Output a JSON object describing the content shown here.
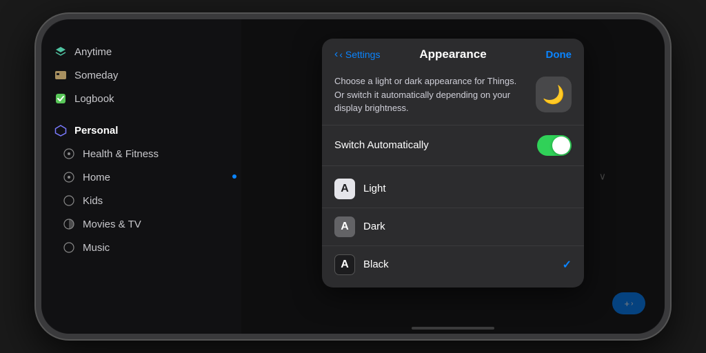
{
  "phone": {
    "sidebar": {
      "items": [
        {
          "id": "anytime",
          "label": "Anytime",
          "icon": "⊞",
          "iconClass": "icon-layers",
          "active": false
        },
        {
          "id": "someday",
          "label": "Someday",
          "icon": "▭",
          "iconClass": "icon-someday",
          "active": false
        },
        {
          "id": "logbook",
          "label": "Logbook",
          "icon": "✓",
          "iconClass": "icon-logbook",
          "active": false
        }
      ],
      "sections": [
        {
          "label": "Personal",
          "active": true,
          "icon": "⬡",
          "iconClass": "icon-personal"
        }
      ],
      "sub_items": [
        {
          "id": "health",
          "label": "Health & Fitness",
          "icon": "◎",
          "iconClass": "icon-health"
        },
        {
          "id": "home",
          "label": "Home",
          "icon": "◎",
          "iconClass": "icon-home"
        },
        {
          "id": "kids",
          "label": "Kids",
          "icon": "○",
          "iconClass": "icon-kids"
        },
        {
          "id": "movies",
          "label": "Movies & TV",
          "icon": "◑",
          "iconClass": "icon-movies"
        },
        {
          "id": "music",
          "label": "Music",
          "icon": "○",
          "iconClass": "icon-music"
        }
      ]
    },
    "fab": {
      "label": "+ ›"
    }
  },
  "modal": {
    "header": {
      "back_label": "‹ Settings",
      "title": "Appearance",
      "done_label": "Done"
    },
    "description": "Choose a light or dark appearance for Things. Or switch it automatically depending on your display brightness.",
    "moon_icon": "🌙",
    "switch_row": {
      "label": "Switch Automatically",
      "enabled": true
    },
    "options": [
      {
        "id": "light",
        "label": "Light",
        "icon": "A",
        "selected": false
      },
      {
        "id": "dark",
        "label": "Dark",
        "icon": "A",
        "selected": false
      },
      {
        "id": "black",
        "label": "Black",
        "icon": "A",
        "selected": true
      }
    ]
  }
}
